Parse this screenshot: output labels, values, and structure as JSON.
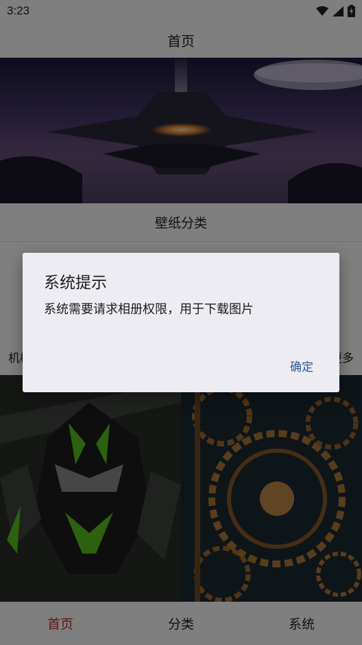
{
  "status_bar": {
    "time": "3:23",
    "icons": [
      "wifi-icon",
      "signal-icon",
      "battery-charging-icon"
    ]
  },
  "header": {
    "title": "首页"
  },
  "banner": {
    "image": "sci-fi spaceship over alien landscape"
  },
  "section": {
    "title": "壁纸分类"
  },
  "sub_row": {
    "left_label": "机械",
    "right_label": "更多"
  },
  "gallery": {
    "tiles": [
      "green black mecha robot",
      "steampunk gears clockwork"
    ]
  },
  "tab_bar": {
    "tabs": [
      {
        "label": "首页",
        "active": true
      },
      {
        "label": "分类",
        "active": false
      },
      {
        "label": "系统",
        "active": false
      }
    ]
  },
  "dialog": {
    "title": "系统提示",
    "message": "系统需要请求相册权限，用于下载图片",
    "confirm_label": "确定"
  },
  "colors": {
    "accent_active_tab": "#c62828",
    "dialog_button": "#2e5a8a",
    "dialog_bg": "#ececf2"
  }
}
